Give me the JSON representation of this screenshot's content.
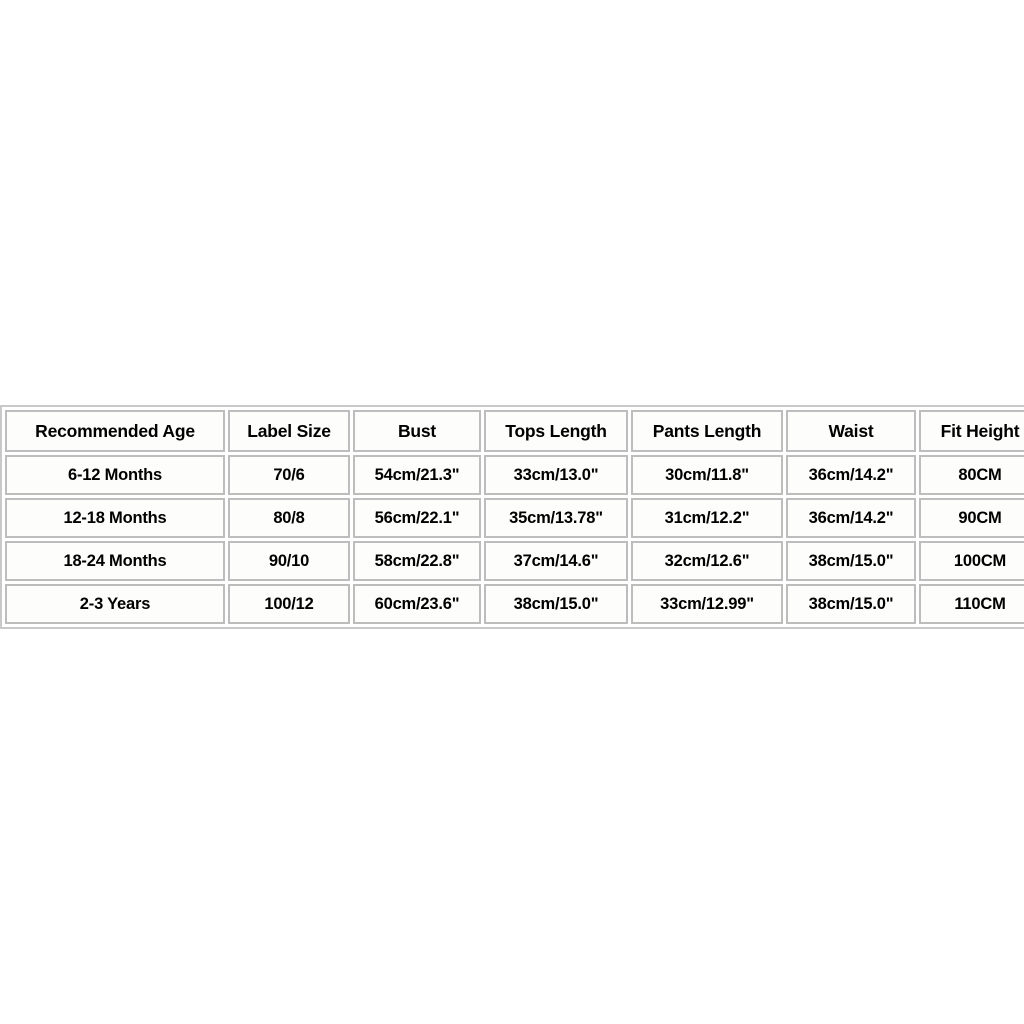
{
  "chart_data": {
    "type": "table",
    "title": "",
    "columns": [
      "Recommended Age",
      "Label Size",
      "Bust",
      "Tops Length",
      "Pants Length",
      "Waist",
      "Fit Height"
    ],
    "rows": [
      [
        "6-12 Months",
        "70/6",
        "54cm/21.3\"",
        "33cm/13.0\"",
        "30cm/11.8\"",
        "36cm/14.2\"",
        "80CM"
      ],
      [
        "12-18 Months",
        "80/8",
        "56cm/22.1\"",
        "35cm/13.78\"",
        "31cm/12.2\"",
        "36cm/14.2\"",
        "90CM"
      ],
      [
        "18-24 Months",
        "90/10",
        "58cm/22.8\"",
        "37cm/14.6\"",
        "32cm/12.6\"",
        "38cm/15.0\"",
        "100CM"
      ],
      [
        "2-3 Years",
        "100/12",
        "60cm/23.6\"",
        "38cm/15.0\"",
        "33cm/12.99\"",
        "38cm/15.0\"",
        "110CM"
      ]
    ]
  },
  "table": {
    "headers": [
      "Recommended Age",
      "Label Size",
      "Bust",
      "Tops Length",
      "Pants Length",
      "Waist",
      "Fit Height"
    ],
    "rows": [
      {
        "recommended_age": "6-12 Months",
        "label_size": "70/6",
        "bust": "54cm/21.3\"",
        "tops_length": "33cm/13.0\"",
        "pants_length": "30cm/11.8\"",
        "waist": "36cm/14.2\"",
        "fit_height": "80CM"
      },
      {
        "recommended_age": "12-18 Months",
        "label_size": "80/8",
        "bust": "56cm/22.1\"",
        "tops_length": "35cm/13.78\"",
        "pants_length": "31cm/12.2\"",
        "waist": "36cm/14.2\"",
        "fit_height": "90CM"
      },
      {
        "recommended_age": "18-24 Months",
        "label_size": "90/10",
        "bust": "58cm/22.8\"",
        "tops_length": "37cm/14.6\"",
        "pants_length": "32cm/12.6\"",
        "waist": "38cm/15.0\"",
        "fit_height": "100CM"
      },
      {
        "recommended_age": "2-3 Years",
        "label_size": "100/12",
        "bust": "60cm/23.6\"",
        "tops_length": "38cm/15.0\"",
        "pants_length": "33cm/12.99\"",
        "waist": "38cm/15.0\"",
        "fit_height": "110CM"
      }
    ]
  },
  "colors": {
    "background": "#ffffff",
    "cell_background": "#fdfdfb",
    "border": "#bdbdbd",
    "outer_border": "#c9c9c9",
    "text": "#000000"
  }
}
